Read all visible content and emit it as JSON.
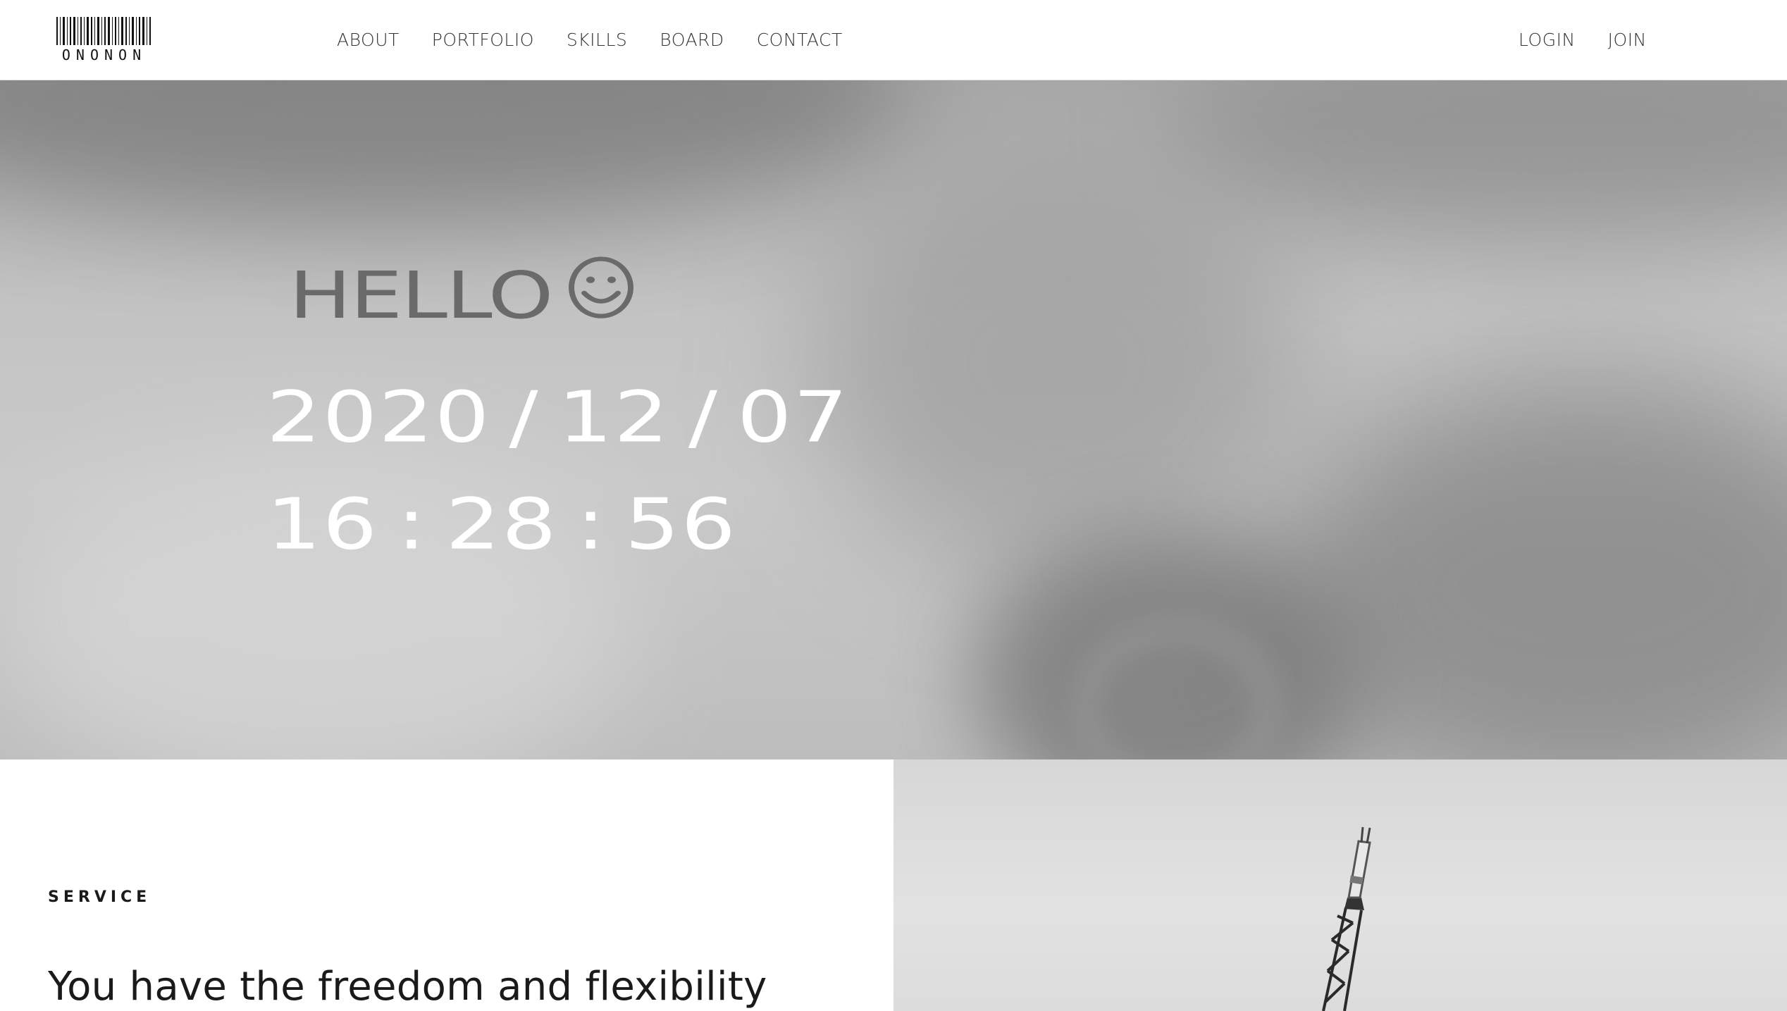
{
  "header": {
    "logo_text": "ONONON",
    "nav": [
      "ABOUT",
      "PORTFOLIO",
      "SKILLS",
      "BOARD",
      "CONTACT"
    ],
    "auth": [
      "LOGIN",
      "JOIN"
    ]
  },
  "hero": {
    "greeting": "HELLO",
    "date": {
      "year": "2020",
      "month": "12",
      "day": "07",
      "separator": "/"
    },
    "time": {
      "hours": "16",
      "minutes": "28",
      "seconds": "56",
      "separator": ":"
    }
  },
  "service": {
    "label": "SERVICE",
    "title": "You have the freedom and flexibility"
  },
  "colors": {
    "greeting": "#6a6a6a",
    "clock": "#ffffff",
    "text": "#1a1a1a"
  },
  "icons": [
    "barcode-logo-icon",
    "smiley-icon",
    "crane-image"
  ]
}
